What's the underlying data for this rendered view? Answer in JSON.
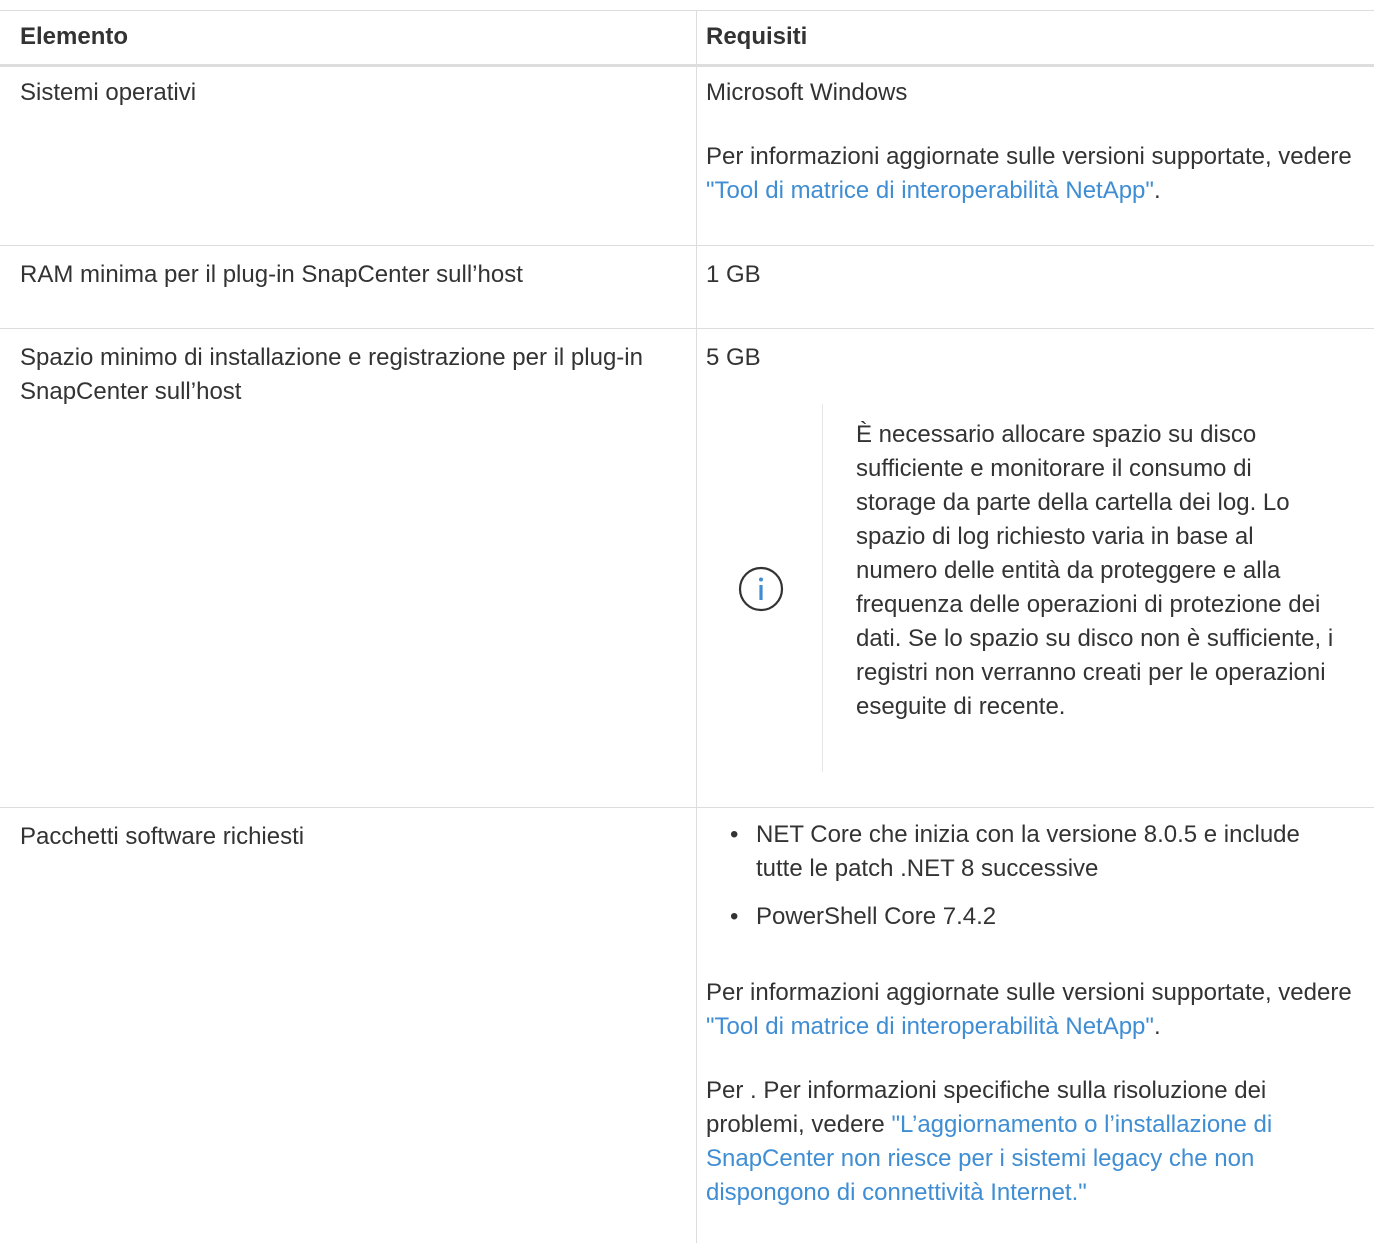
{
  "table": {
    "headers": {
      "element": "Elemento",
      "requirements": "Requisiti"
    },
    "rows": [
      {
        "element": "Sistemi operativi",
        "req_main": "Microsoft Windows",
        "req_info_prefix": "Per informazioni aggiornate sulle versioni supportate, vedere ",
        "req_info_link": "\"Tool di matrice di interoperabilità NetApp\"",
        "req_info_suffix": "."
      },
      {
        "element": "RAM minima per il plug-in SnapCenter sull’host",
        "req_main": "1 GB"
      },
      {
        "element": "Spazio minimo di installazione e registrazione per il plug-in SnapCenter sull’host",
        "req_main": "5 GB",
        "note_icon": "info-icon",
        "note_text": "È necessario allocare spazio su disco sufficiente e monitorare il consumo di storage da parte della cartella dei log. Lo spazio di log richiesto varia in base al numero delle entità da proteggere e alla frequenza delle operazioni di protezione dei dati. Se lo spazio su disco non è sufficiente, i registri non verranno creati per le operazioni eseguite di recente."
      },
      {
        "element": "Pacchetti software richiesti",
        "bullets": [
          "NET Core che inizia con la versione 8.0.5 e include tutte le patch .NET 8 successive",
          "PowerShell Core 7.4.2"
        ],
        "bullet_char": "•",
        "req_info_prefix": "Per informazioni aggiornate sulle versioni supportate, vedere ",
        "req_info_link": "\"Tool di matrice di interoperabilità NetApp\"",
        "req_info_suffix": ".",
        "trouble_prefix": "Per . Per informazioni specifiche sulla risoluzione dei problemi, vedere ",
        "trouble_link": "\"L’aggiornamento o l’installazione di SnapCenter non riesce per i sistemi legacy che non dispongono di connettività Internet.\""
      }
    ]
  },
  "colors": {
    "link": "#3f8dd3",
    "text": "#333333",
    "grid": "#dddddd"
  }
}
